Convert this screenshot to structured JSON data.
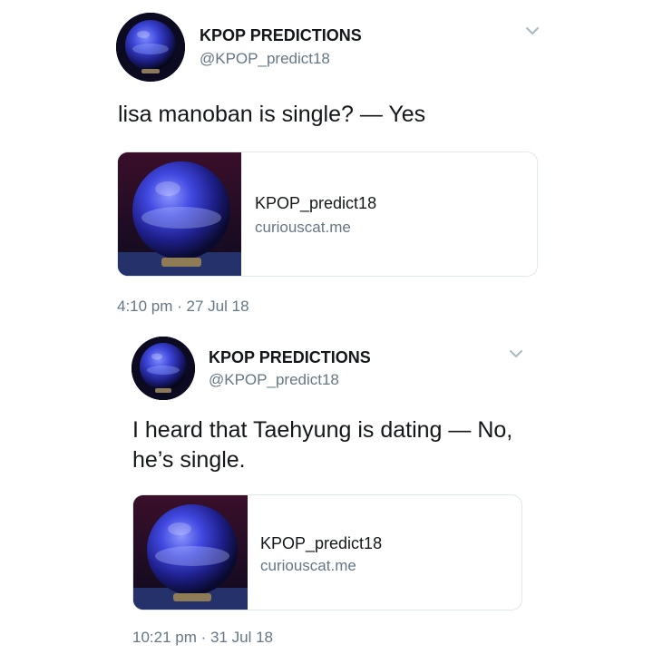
{
  "tweets": [
    {
      "author_name": "KPOP PREDICTIONS",
      "author_handle": "@KPOP_predict18",
      "text": "lisa manoban is single? — Yes",
      "card": {
        "title": "KPOP_predict18",
        "domain": "curiouscat.me"
      },
      "timestamp": "4:10 pm · 27 Jul 18"
    },
    {
      "author_name": "KPOP PREDICTIONS",
      "author_handle": "@KPOP_predict18",
      "text_line1": "I heard that Taehyung is dating — No,",
      "text_line2": "he’s single.",
      "card": {
        "title": "KPOP_predict18",
        "domain": "curiouscat.me"
      },
      "timestamp": "10:21 pm · 31 Jul 18"
    }
  ],
  "icons": {
    "avatar": "crystal-ball-avatar",
    "menu": "chevron-down-icon",
    "card_thumbnail": "crystal-ball-image"
  },
  "colors": {
    "text_primary": "#14171a",
    "text_secondary": "#657786",
    "card_border": "#e1e8ed",
    "chevron": "#aab8c2"
  }
}
